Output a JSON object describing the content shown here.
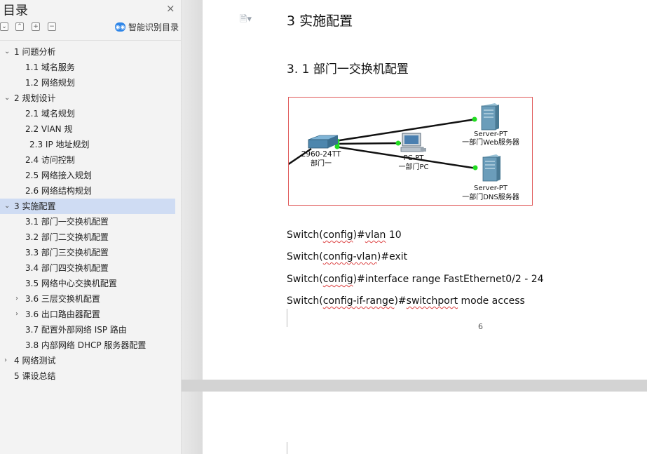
{
  "sidebar": {
    "title": "目录",
    "close_icon": "×",
    "tools": [
      "⌄",
      "⌃",
      "+",
      "−"
    ],
    "smart_label": "智能识别目录",
    "toc": [
      {
        "label": "1  问题分析",
        "level": 1,
        "expand": "⌄"
      },
      {
        "label": "1.1 域名服务",
        "level": 2
      },
      {
        "label": "1.2 网络规划",
        "level": 2
      },
      {
        "label": "2  规划设计",
        "level": 1,
        "expand": "⌄"
      },
      {
        "label": "2.1 域名规划",
        "level": 2
      },
      {
        "label": "2.2 VlAN 规",
        "level": 2
      },
      {
        "label": "2.3 IP 地址规划",
        "level": 2,
        "indent": 6
      },
      {
        "label": "2.4  访问控制",
        "level": 2
      },
      {
        "label": "2.5  网络接入规划",
        "level": 2
      },
      {
        "label": "2.6  网络结构规划",
        "level": 2
      },
      {
        "label": "3  实施配置",
        "level": 1,
        "expand": "⌄",
        "active": true
      },
      {
        "label": "3.1 部门一交换机配置",
        "level": 2
      },
      {
        "label": "3.2 部门二交换机配置",
        "level": 2
      },
      {
        "label": "3.3 部门三交换机配置",
        "level": 2
      },
      {
        "label": "3.4 部门四交换机配置",
        "level": 2
      },
      {
        "label": "3.5 网络中心交换机配置",
        "level": 2
      },
      {
        "label": "3.6 三层交换机配置",
        "level": 2,
        "expand": "›"
      },
      {
        "label": "3.6 出口路由器配置",
        "level": 2,
        "expand": "›"
      },
      {
        "label": "3.7 配置外部网络 ISP 路由",
        "level": 2
      },
      {
        "label": "3.8 内部网络 DHCP 服务器配置",
        "level": 2
      },
      {
        "label": "4 网络测试",
        "level": 1,
        "expand": "›"
      },
      {
        "label": "5  课设总结",
        "level": 1
      }
    ]
  },
  "document": {
    "heading1": "3  实施配置",
    "heading2": "3. 1 部门一交换机配置",
    "page_number": "6",
    "commands": [
      {
        "pre": "Switch(",
        "sq": "config",
        "post": ")#",
        "sq2": "vlan",
        "post2": " 10"
      },
      {
        "pre": "Switch(",
        "sq": "config-vlan",
        "post": ")#exit",
        "sq2": "",
        "post2": ""
      },
      {
        "pre": "Switch(",
        "sq": "config",
        "post": ")#interface range FastEthernet0/2 - 24",
        "sq2": "",
        "post2": ""
      },
      {
        "pre": "Switch(",
        "sq": "config-if-range",
        "post": ")#",
        "sq2": "switchport",
        "post2": " mode access"
      }
    ]
  },
  "diagram": {
    "switch_model": "2960-24TT",
    "switch_name": "部门一",
    "pc_model": "PC-PT",
    "pc_name": "一部门PC",
    "server1_model": "Server-PT",
    "server1_name": "一部门Web服务器",
    "server2_model": "Server-PT",
    "server2_name": "一部门DNS服务器",
    "colors": {
      "link": "#111111",
      "port": "#22dd22",
      "device": "#5b8fb0",
      "border": "#e05a5a"
    }
  }
}
